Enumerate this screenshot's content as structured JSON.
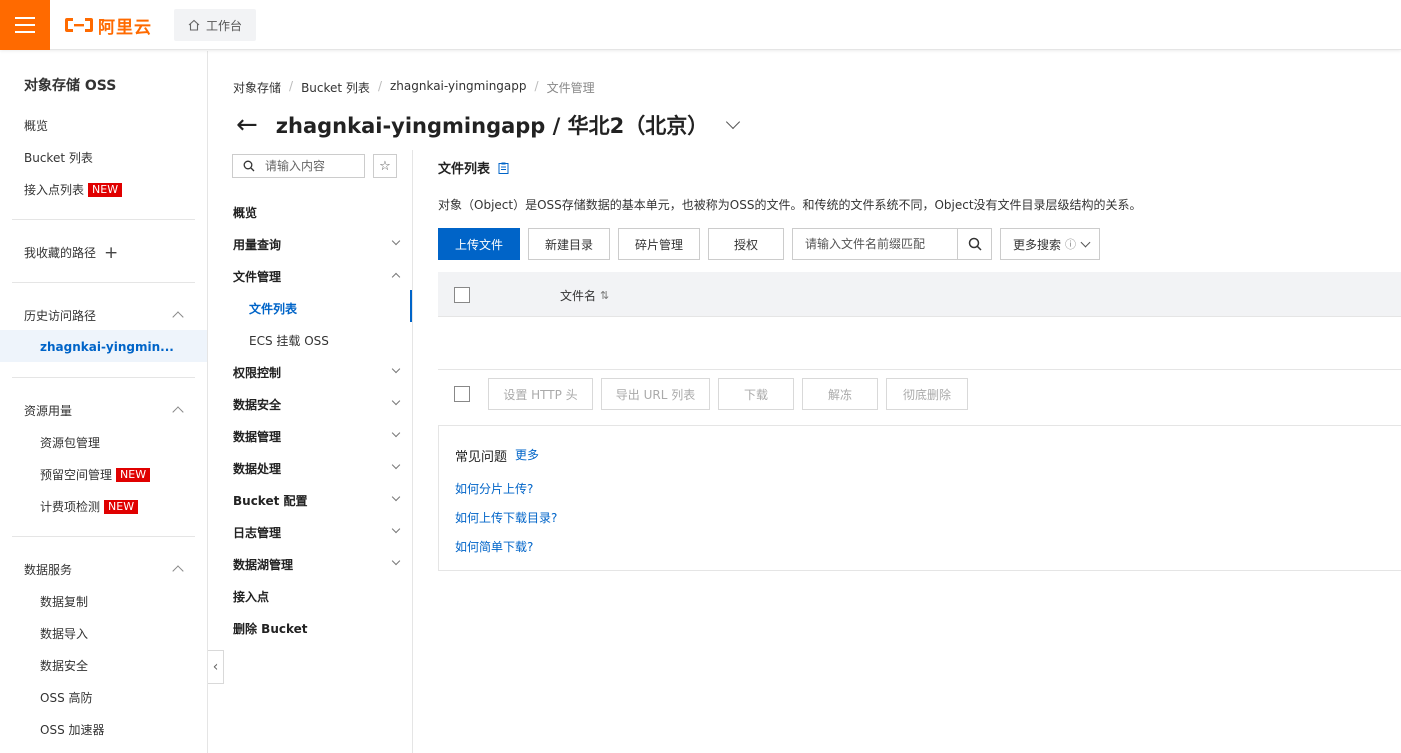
{
  "brand": {
    "logo_text": "阿里云",
    "accent": "#ff6a00",
    "link_color": "#0064c8"
  },
  "topbar": {
    "workbench_label": "工作台"
  },
  "sidebar": {
    "title": "对象存储 OSS",
    "items": {
      "overview": "概览",
      "bucket_list": "Bucket 列表",
      "access_points": "接入点列表",
      "favorites": "我收藏的路径",
      "history": "历史访问路径",
      "history_item": "zhagnkai-yingmin...",
      "resource_usage": "资源用量",
      "resource_pack": "资源包管理",
      "reserved_space": "预留空间管理",
      "billing_check": "计费项检测",
      "data_services": "数据服务",
      "data_replication": "数据复制",
      "data_import": "数据导入",
      "data_security": "数据安全",
      "oss_ddos": "OSS 高防",
      "oss_accelerator": "OSS 加速器"
    },
    "badge_new": "NEW"
  },
  "breadcrumb": [
    "对象存储",
    "Bucket 列表",
    "zhagnkai-yingmingapp",
    "文件管理"
  ],
  "breadcrumb_sep": "/",
  "page_title": "zhagnkai-yingmingapp / 华北2（北京）",
  "subnav": {
    "search_placeholder": "请输入内容",
    "items": {
      "overview": "概览",
      "usage_query": "用量查询",
      "file_management": "文件管理",
      "file_list": "文件列表",
      "ecs_mount": "ECS 挂载 OSS",
      "permission": "权限控制",
      "data_security": "数据安全",
      "data_management": "数据管理",
      "data_processing": "数据处理",
      "bucket_config": "Bucket 配置",
      "log_management": "日志管理",
      "data_lake": "数据湖管理",
      "access_point": "接入点",
      "delete_bucket": "删除 Bucket"
    }
  },
  "main": {
    "section_title": "文件列表",
    "description": "对象（Object）是OSS存储数据的基本单元，也被称为OSS的文件。和传统的文件系统不同，Object没有文件目录层级结构的关系。",
    "buttons": {
      "upload": "上传文件",
      "new_dir": "新建目录",
      "fragments": "碎片管理",
      "authorize": "授权",
      "more_search": "更多搜索"
    },
    "file_search_placeholder": "请输入文件名前缀匹配",
    "table": {
      "col_name": "文件名"
    },
    "bulk": {
      "set_http": "设置 HTTP 头",
      "export_url": "导出 URL 列表",
      "download": "下载",
      "unfreeze": "解冻",
      "delete": "彻底删除"
    },
    "faq": {
      "title": "常见问题",
      "more": "更多",
      "links": [
        "如何分片上传?",
        "如何上传下载目录?",
        "如何简单下载?"
      ]
    }
  }
}
